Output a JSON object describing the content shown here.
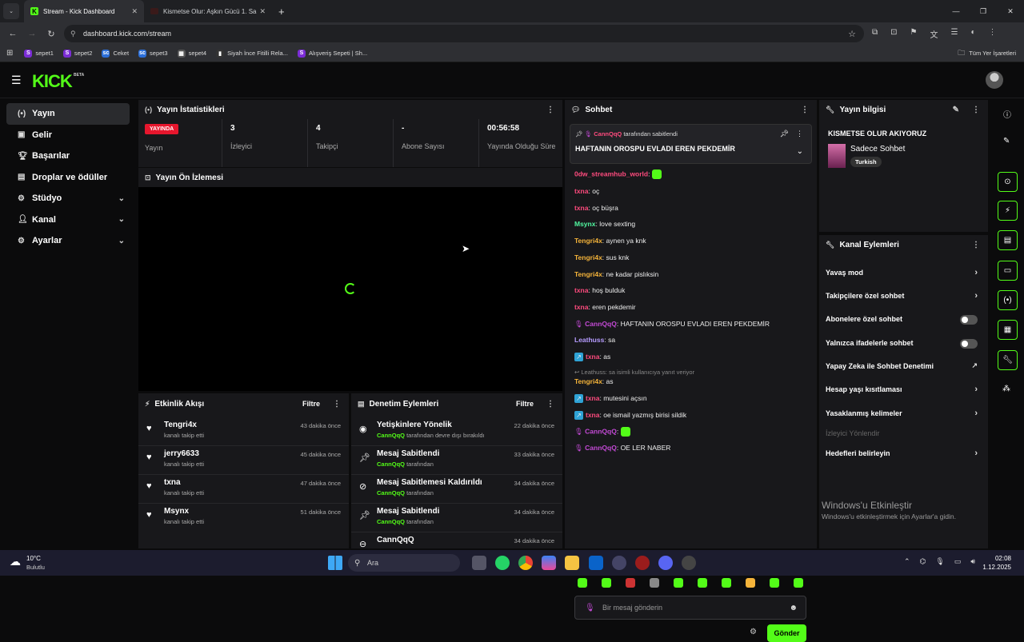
{
  "browser": {
    "tabs": [
      {
        "title": "Stream - Kick Dashboard",
        "active": true
      },
      {
        "title": "Kismetse Olur: Aşkın Gücü 1. Sa",
        "active": false
      }
    ],
    "url": "dashboard.kick.com/stream",
    "bookmarks": [
      "sepet1",
      "sepet2",
      "Ceket",
      "sepet3",
      "sepet4",
      "Siyah İnce Fitilli Rela...",
      "Alışveriş Sepeti | Sh..."
    ],
    "bookmarks_right": "Tüm Yer İşaretleri"
  },
  "app": {
    "logo": "KICK",
    "beta": "BETA"
  },
  "sidebar": {
    "items": [
      {
        "label": "Yayın",
        "icon": "broadcast-icon",
        "active": true
      },
      {
        "label": "Gelir",
        "icon": "wallet-icon"
      },
      {
        "label": "Başarılar",
        "icon": "trophy-icon"
      },
      {
        "label": "Droplar ve ödüller",
        "icon": "gift-icon"
      },
      {
        "label": "Stüdyo",
        "icon": "gear-icon",
        "chevron": true
      },
      {
        "label": "Kanal",
        "icon": "user-icon",
        "chevron": true
      },
      {
        "label": "Ayarlar",
        "icon": "cog-icon",
        "chevron": true
      }
    ]
  },
  "stats": {
    "title": "Yayın İstatistikleri",
    "live_badge": "YAYINDA",
    "items": [
      {
        "value": "",
        "label": "Yayın"
      },
      {
        "value": "3",
        "label": "İzleyici"
      },
      {
        "value": "4",
        "label": "Takipçi"
      },
      {
        "value": "-",
        "label": "Abone Sayısı"
      },
      {
        "value": "00:56:58",
        "label": "Yayında Olduğu Süre"
      }
    ]
  },
  "preview": {
    "title": "Yayın Ön İzlemesi"
  },
  "activity": {
    "title": "Etkinlik Akışı",
    "filter": "Filtre",
    "rows": [
      {
        "name": "Tengri4x",
        "sub": "kanalı takip etti",
        "time": "43 dakika önce"
      },
      {
        "name": "jerry6633",
        "sub": "kanalı takip etti",
        "time": "45 dakika önce"
      },
      {
        "name": "txna",
        "sub": "kanalı takip etti",
        "time": "47 dakika önce"
      },
      {
        "name": "Msynx",
        "sub": "kanalı takip etti",
        "time": "51 dakika önce"
      }
    ]
  },
  "moderation": {
    "title": "Denetim Eylemleri",
    "filter": "Filtre",
    "rows": [
      {
        "title": "Yetişkinlere Yönelik",
        "user": "CannQqQ",
        "sub": "tarafından devre dışı bırakıldı",
        "time": "22 dakika önce",
        "icon": "eye-icon"
      },
      {
        "title": "Mesaj Sabitlendi",
        "user": "CannQqQ",
        "sub": "tarafından",
        "time": "33 dakika önce",
        "icon": "pin-icon"
      },
      {
        "title": "Mesaj Sabitlemesi Kaldırıldı",
        "user": "CannQqQ",
        "sub": "tarafından",
        "time": "34 dakika önce",
        "icon": "unpin-icon"
      },
      {
        "title": "Mesaj Sabitlendi",
        "user": "CannQqQ",
        "sub": "tarafından",
        "time": "34 dakika önce",
        "icon": "pin-icon"
      },
      {
        "title": "CannQqQ",
        "user": "",
        "sub": "",
        "time": "34 dakika önce",
        "icon": "ban-icon"
      }
    ]
  },
  "chat": {
    "title": "Sohbet",
    "pinned_by_user": "CannQqQ",
    "pinned_by_suffix": "tarafından sabitlendi",
    "pinned_text": "HAFTANIN OROSPU EVLADI EREN PEKDEMİR",
    "messages": [
      {
        "user": "0dw_streamhub_world",
        "text": "",
        "cls": "u1",
        "emote": true
      },
      {
        "user": "txna",
        "text": "oç",
        "cls": "u1"
      },
      {
        "user": "txna",
        "text": "oç büşra",
        "cls": "u1"
      },
      {
        "user": "Msynx",
        "text": "love sexting",
        "cls": "u3"
      },
      {
        "user": "Tengri4x",
        "text": "aynen ya knk",
        "cls": "u4"
      },
      {
        "user": "Tengri4x",
        "text": "sus knk",
        "cls": "u4"
      },
      {
        "user": "Tengri4x",
        "text": "ne kadar pislıksin",
        "cls": "u4"
      },
      {
        "user": "txna",
        "text": "hoş bulduk",
        "cls": "u1"
      },
      {
        "user": "txna",
        "text": "eren pekdemir",
        "cls": "u1"
      },
      {
        "user": "CannQqQ",
        "text": "HAFTANIN OROSPU EVLADI EREN PEKDEMİR",
        "cls": "u6",
        "mic": true
      },
      {
        "user": "Leathuss",
        "text": "sa",
        "cls": "u5"
      },
      {
        "user": "txna",
        "text": "as",
        "cls": "u1",
        "badge": true
      },
      {
        "reply": "Leathuss: sa isimli kullanıcıya yanıt veriyor"
      },
      {
        "user": "Tengri4x",
        "text": "as",
        "cls": "u4"
      },
      {
        "user": "txna",
        "text": "mutesini açsın",
        "cls": "u1",
        "badge": true
      },
      {
        "user": "txna",
        "text": "oe ismail yazmış birisi sildik",
        "cls": "u1",
        "badge": true
      },
      {
        "user": "CannQqQ",
        "text": "",
        "cls": "u6",
        "mic": true,
        "emote": true
      },
      {
        "user": "CannQqQ",
        "text": "OE LER NABER",
        "cls": "u6",
        "mic": true
      }
    ],
    "input_placeholder": "Bir mesaj gönderin",
    "send": "Gönder"
  },
  "stream_info": {
    "title": "Yayın bilgisi",
    "stream_title": "KISMETSE OLUR AKIYORUZ",
    "chat_mode": "Sadece Sohbet",
    "tag": "Turkish"
  },
  "channel_actions": {
    "title": "Kanal Eylemleri",
    "items": [
      {
        "label": "Yavaş mod",
        "kind": "chevron"
      },
      {
        "label": "Takipçilere özel sohbet",
        "kind": "chevron"
      },
      {
        "label": "Abonelere özel sohbet",
        "kind": "toggle"
      },
      {
        "label": "Yalnızca ifadelerle sohbet",
        "kind": "toggle"
      },
      {
        "label": "Yapay Zeka ile Sohbet Denetimi",
        "kind": "external"
      },
      {
        "label": "Hesap yaşı kısıtlaması",
        "kind": "chevron"
      },
      {
        "label": "Yasaklanmış kelimeler",
        "kind": "chevron"
      },
      {
        "label": "İzleyici Yönlendir",
        "kind": "disabled"
      },
      {
        "label": "Hedefleri belirleyin",
        "kind": "chevron"
      }
    ]
  },
  "watermark": {
    "title": "Windows'u Etkinleştir",
    "sub": "Windows'u etkinleştirmek için Ayarlar'a gidin."
  },
  "taskbar": {
    "weather_temp": "10°C",
    "weather_desc": "Bulutlu",
    "search": "Ara",
    "time": "02:08",
    "date": "1.12.2025"
  }
}
